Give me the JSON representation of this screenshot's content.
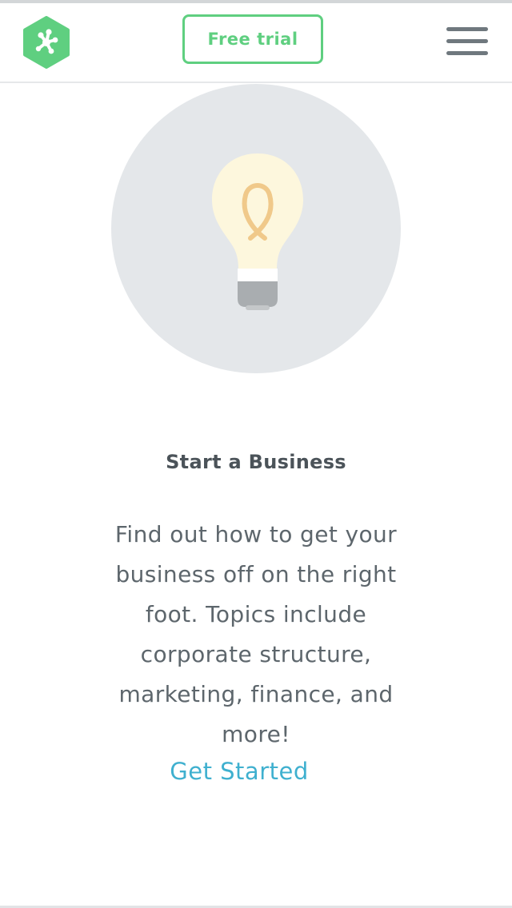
{
  "header": {
    "logo_icon": "treehouse-frog-logo",
    "trial_label": "Free trial",
    "menu_icon": "hamburger-menu-icon"
  },
  "hero": {
    "illustration_icon": "lightbulb-icon"
  },
  "content": {
    "title": "Start a Business",
    "description": "Find out how to get your business off on the right foot. Topics include corporate structure, marketing, finance, and more!",
    "cta_label": "Get Started"
  },
  "colors": {
    "brand_green": "#5fcf80",
    "link_blue": "#3fb0cf",
    "circle_gray": "#e4e7ea",
    "text_dark": "#4b5359"
  }
}
